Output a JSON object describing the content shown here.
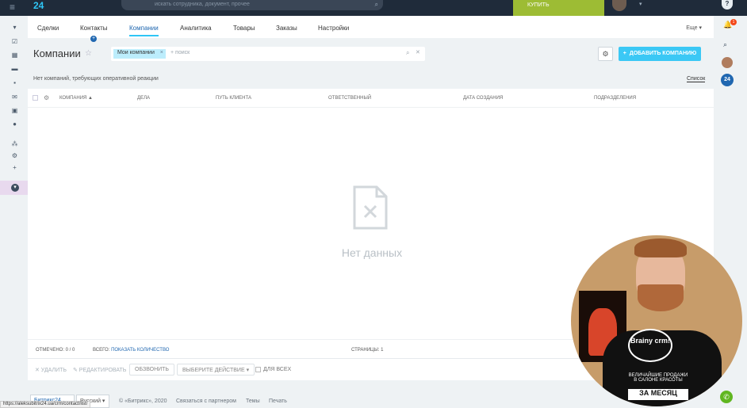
{
  "header": {
    "logo": "24",
    "search_placeholder": "искать сотрудника, документ, прочее",
    "buy_label": "КУПИТЬ"
  },
  "nav": {
    "tabs": [
      {
        "label": "Сделки"
      },
      {
        "label": "Контакты"
      },
      {
        "label": "Компании"
      },
      {
        "label": "Аналитика"
      },
      {
        "label": "Товары"
      },
      {
        "label": "Заказы"
      },
      {
        "label": "Настройки"
      }
    ],
    "more_label": "Еще"
  },
  "page": {
    "title": "Компании",
    "filter_tag": "Мои компании",
    "filter_search": "+ поиск",
    "add_button": "ДОБАВИТЬ КОМПАНИЮ",
    "info_text": "Нет компаний, требующих оперативной реакции",
    "list_link": "Список"
  },
  "grid": {
    "columns": [
      "КОМПАНИЯ ▲",
      "ДЕЛА",
      "ПУТЬ КЛИЕНТА",
      "ОТВЕТСТВЕННЫЙ",
      "ДАТА СОЗДАНИЯ",
      "ПОДРАЗДЕЛЕНИЯ"
    ],
    "empty_text": "Нет данных",
    "footer": {
      "selected": "ОТМЕЧЕНО: 0 / 0",
      "total_prefix": "ВСЕГО:",
      "total_link": "ПОКАЗАТЬ КОЛИЧЕСТВО",
      "pages": "СТРАНИЦЫ: 1"
    }
  },
  "actions": {
    "delete": "✕ УДАЛИТЬ",
    "edit": "✎ РЕДАКТИРОВАТЬ",
    "call": "ОБЗВОНИТЬ",
    "choose_action": "ВЫБЕРИТЕ ДЕЙСТВИЕ",
    "for_all": "ДЛЯ ВСЕХ"
  },
  "footer": {
    "bitrix_btn": "Битрикс24",
    "lang": "Русский",
    "copyright": "© «Битрикс», 2020",
    "partners": "Связаться с партнером",
    "themes": "Темы",
    "print": "Печать",
    "status_url": "https://aleksubitrix24.ua/crm/contact/list/"
  },
  "webcam": {
    "logo_text": "Brainy crm!",
    "line1": "ВЕЛИЧАЙШИЕ ПРОДАЖИ В САЛОНЕ КРАСОТЫ",
    "line2": "ЗА МЕСЯЦ"
  }
}
